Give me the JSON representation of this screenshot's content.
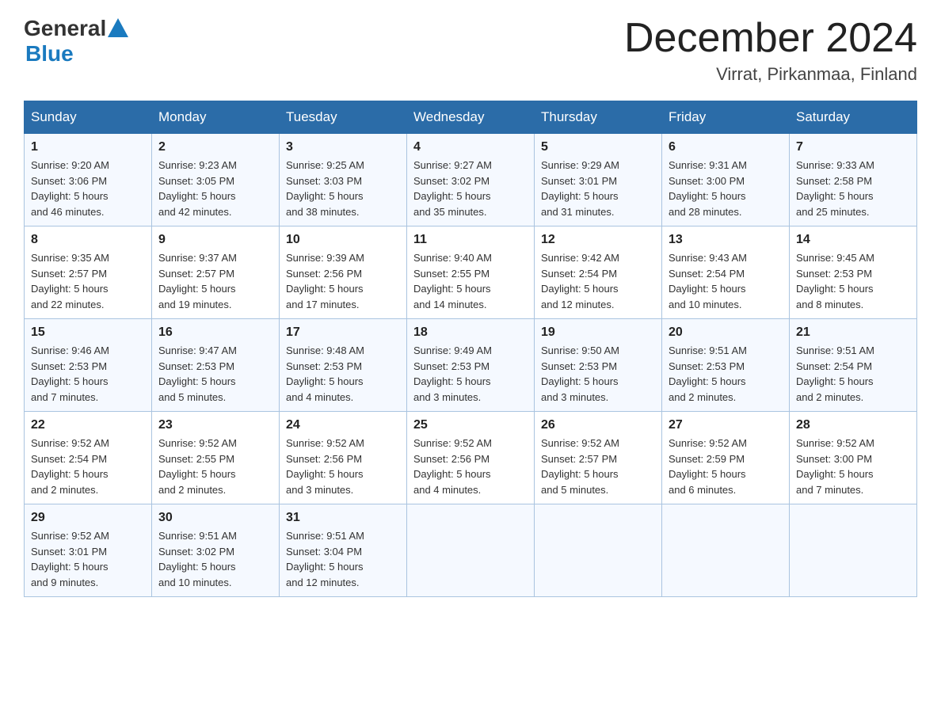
{
  "header": {
    "logo": {
      "general": "General",
      "blue": "Blue"
    },
    "title": "December 2024",
    "location": "Virrat, Pirkanmaa, Finland"
  },
  "days_of_week": [
    "Sunday",
    "Monday",
    "Tuesday",
    "Wednesday",
    "Thursday",
    "Friday",
    "Saturday"
  ],
  "weeks": [
    [
      {
        "day": "1",
        "sunrise": "9:20 AM",
        "sunset": "3:06 PM",
        "daylight": "5 hours and 46 minutes."
      },
      {
        "day": "2",
        "sunrise": "9:23 AM",
        "sunset": "3:05 PM",
        "daylight": "5 hours and 42 minutes."
      },
      {
        "day": "3",
        "sunrise": "9:25 AM",
        "sunset": "3:03 PM",
        "daylight": "5 hours and 38 minutes."
      },
      {
        "day": "4",
        "sunrise": "9:27 AM",
        "sunset": "3:02 PM",
        "daylight": "5 hours and 35 minutes."
      },
      {
        "day": "5",
        "sunrise": "9:29 AM",
        "sunset": "3:01 PM",
        "daylight": "5 hours and 31 minutes."
      },
      {
        "day": "6",
        "sunrise": "9:31 AM",
        "sunset": "3:00 PM",
        "daylight": "5 hours and 28 minutes."
      },
      {
        "day": "7",
        "sunrise": "9:33 AM",
        "sunset": "2:58 PM",
        "daylight": "5 hours and 25 minutes."
      }
    ],
    [
      {
        "day": "8",
        "sunrise": "9:35 AM",
        "sunset": "2:57 PM",
        "daylight": "5 hours and 22 minutes."
      },
      {
        "day": "9",
        "sunrise": "9:37 AM",
        "sunset": "2:57 PM",
        "daylight": "5 hours and 19 minutes."
      },
      {
        "day": "10",
        "sunrise": "9:39 AM",
        "sunset": "2:56 PM",
        "daylight": "5 hours and 17 minutes."
      },
      {
        "day": "11",
        "sunrise": "9:40 AM",
        "sunset": "2:55 PM",
        "daylight": "5 hours and 14 minutes."
      },
      {
        "day": "12",
        "sunrise": "9:42 AM",
        "sunset": "2:54 PM",
        "daylight": "5 hours and 12 minutes."
      },
      {
        "day": "13",
        "sunrise": "9:43 AM",
        "sunset": "2:54 PM",
        "daylight": "5 hours and 10 minutes."
      },
      {
        "day": "14",
        "sunrise": "9:45 AM",
        "sunset": "2:53 PM",
        "daylight": "5 hours and 8 minutes."
      }
    ],
    [
      {
        "day": "15",
        "sunrise": "9:46 AM",
        "sunset": "2:53 PM",
        "daylight": "5 hours and 7 minutes."
      },
      {
        "day": "16",
        "sunrise": "9:47 AM",
        "sunset": "2:53 PM",
        "daylight": "5 hours and 5 minutes."
      },
      {
        "day": "17",
        "sunrise": "9:48 AM",
        "sunset": "2:53 PM",
        "daylight": "5 hours and 4 minutes."
      },
      {
        "day": "18",
        "sunrise": "9:49 AM",
        "sunset": "2:53 PM",
        "daylight": "5 hours and 3 minutes."
      },
      {
        "day": "19",
        "sunrise": "9:50 AM",
        "sunset": "2:53 PM",
        "daylight": "5 hours and 3 minutes."
      },
      {
        "day": "20",
        "sunrise": "9:51 AM",
        "sunset": "2:53 PM",
        "daylight": "5 hours and 2 minutes."
      },
      {
        "day": "21",
        "sunrise": "9:51 AM",
        "sunset": "2:54 PM",
        "daylight": "5 hours and 2 minutes."
      }
    ],
    [
      {
        "day": "22",
        "sunrise": "9:52 AM",
        "sunset": "2:54 PM",
        "daylight": "5 hours and 2 minutes."
      },
      {
        "day": "23",
        "sunrise": "9:52 AM",
        "sunset": "2:55 PM",
        "daylight": "5 hours and 2 minutes."
      },
      {
        "day": "24",
        "sunrise": "9:52 AM",
        "sunset": "2:56 PM",
        "daylight": "5 hours and 3 minutes."
      },
      {
        "day": "25",
        "sunrise": "9:52 AM",
        "sunset": "2:56 PM",
        "daylight": "5 hours and 4 minutes."
      },
      {
        "day": "26",
        "sunrise": "9:52 AM",
        "sunset": "2:57 PM",
        "daylight": "5 hours and 5 minutes."
      },
      {
        "day": "27",
        "sunrise": "9:52 AM",
        "sunset": "2:59 PM",
        "daylight": "5 hours and 6 minutes."
      },
      {
        "day": "28",
        "sunrise": "9:52 AM",
        "sunset": "3:00 PM",
        "daylight": "5 hours and 7 minutes."
      }
    ],
    [
      {
        "day": "29",
        "sunrise": "9:52 AM",
        "sunset": "3:01 PM",
        "daylight": "5 hours and 9 minutes."
      },
      {
        "day": "30",
        "sunrise": "9:51 AM",
        "sunset": "3:02 PM",
        "daylight": "5 hours and 10 minutes."
      },
      {
        "day": "31",
        "sunrise": "9:51 AM",
        "sunset": "3:04 PM",
        "daylight": "5 hours and 12 minutes."
      },
      null,
      null,
      null,
      null
    ]
  ],
  "labels": {
    "sunrise": "Sunrise:",
    "sunset": "Sunset:",
    "daylight": "Daylight:"
  }
}
